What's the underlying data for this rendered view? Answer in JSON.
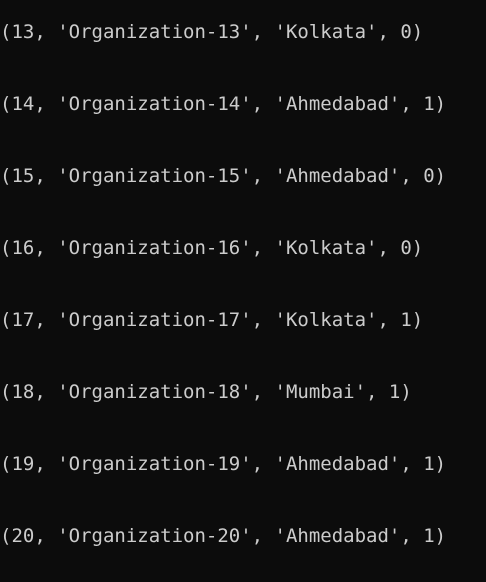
{
  "terminal": {
    "lines": [
      "(13, 'Organization-13', 'Kolkata', 0)",
      "(14, 'Organization-14', 'Ahmedabad', 1)",
      "(15, 'Organization-15', 'Ahmedabad', 0)",
      "(16, 'Organization-16', 'Kolkata', 0)",
      "(17, 'Organization-17', 'Kolkata', 1)",
      "(18, 'Organization-18', 'Mumbai', 1)",
      "(19, 'Organization-19', 'Ahmedabad', 1)",
      "(20, 'Organization-20', 'Ahmedabad', 1)"
    ]
  },
  "colors": {
    "background": "#0c0c0c",
    "text": "#cccccc"
  }
}
